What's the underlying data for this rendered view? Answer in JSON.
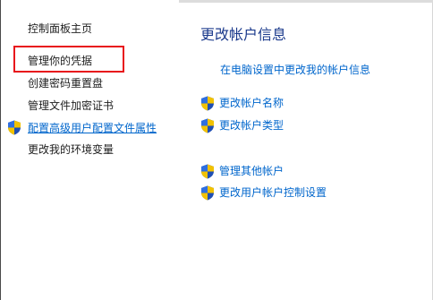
{
  "sidebar": {
    "items": [
      {
        "label": "控制面板主页"
      },
      {
        "label": "管理你的凭据"
      },
      {
        "label": "创建密码重置盘"
      },
      {
        "label": "管理文件加密证书"
      },
      {
        "label": "配置高级用户配置文件属性"
      },
      {
        "label": "更改我的环境变量"
      }
    ]
  },
  "main": {
    "title": "更改帐户信息",
    "pc_settings_link": "在电脑设置中更改我的帐户信息",
    "actions": [
      {
        "label": "更改帐户名称",
        "icon": "uac-shield-icon"
      },
      {
        "label": "更改帐户类型",
        "icon": "uac-shield-icon"
      },
      {
        "label": "管理其他帐户",
        "icon": "uac-shield-icon"
      },
      {
        "label": "更改用户帐户控制设置",
        "icon": "uac-shield-icon"
      }
    ]
  },
  "colors": {
    "link": "#0066cc",
    "title": "#1b3a8c",
    "highlight": "#e8141b"
  }
}
